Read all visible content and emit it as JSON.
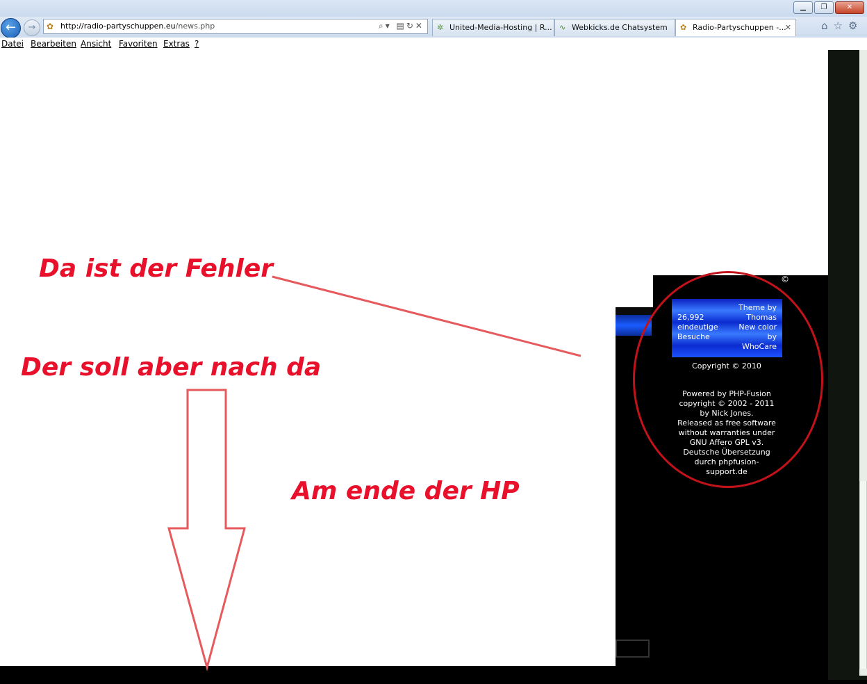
{
  "browser": {
    "url_prefix": "http://radio-partyschuppen.eu",
    "url_path": "/news.php",
    "tabs": [
      {
        "label": "United-Media-Hosting | R..."
      },
      {
        "label": "Webkicks.de Chatsystem"
      },
      {
        "label": "Radio-Partyschuppen -..."
      }
    ],
    "menu": [
      "Datei",
      "Bearbeiten",
      "Ansicht",
      "Favoriten",
      "Extras",
      "?"
    ]
  },
  "page": {
    "copyright_symbol": "©",
    "counter": {
      "number": "26,992",
      "line2": "eindeutige",
      "line3": "Besuche",
      "theme_l1": "Theme by",
      "theme_l2": "Thomas",
      "theme_l3": "New color",
      "theme_l4": "by",
      "theme_l5": "WhoCare"
    },
    "copyright_line": "Copyright © 2010",
    "powered": [
      "Powered by PHP-Fusion",
      "copyright © 2002 - 2011",
      "by Nick Jones.",
      "Released as free software",
      "without warranties under",
      "GNU Affero GPL v3.",
      "Deutsche Übersetzung",
      "durch phpfusion-",
      "support.de"
    ]
  },
  "annotations": {
    "error": "Da ist der Fehler",
    "target": "Der  soll  aber nach da",
    "end": "Am ende der HP"
  },
  "colors": {
    "annotation": "#e8102a",
    "counter_blue": "#1a4cff"
  }
}
